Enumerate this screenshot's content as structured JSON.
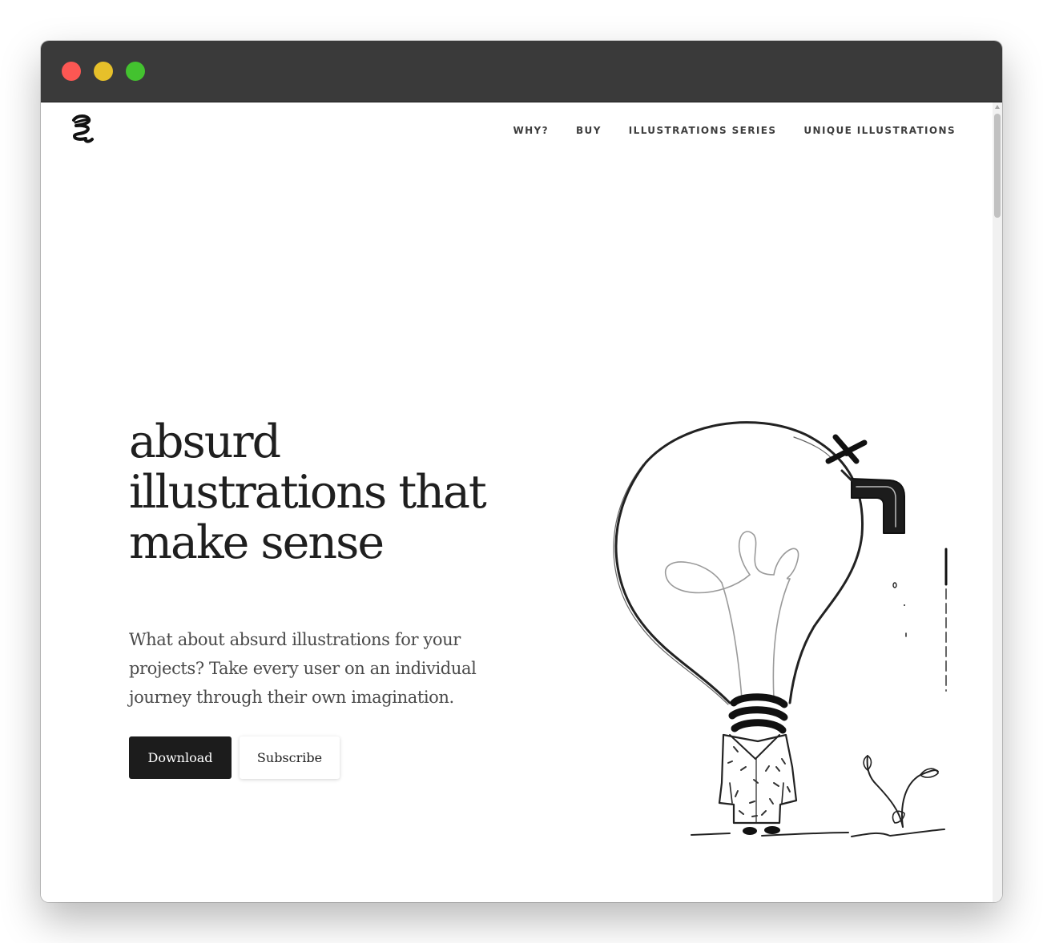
{
  "window": {
    "controls": [
      "close",
      "minimize",
      "maximize"
    ],
    "colors": {
      "close": "#fc5753",
      "minimize": "#e6c02a",
      "maximize": "#43c22f",
      "titlebar": "#3a3a3a"
    }
  },
  "header": {
    "logo_icon": "scribble-logo-icon",
    "nav": [
      "WHY?",
      "BUY",
      "ILLUSTRATIONS SERIES",
      "UNIQUE ILLUSTRATIONS"
    ]
  },
  "hero": {
    "title": "absurd illustrations that make sense",
    "subtitle": "What about absurd illustrations for your projects? Take every user on an individual journey through their own imagination.",
    "buttons": {
      "primary": "Download",
      "secondary": "Subscribe"
    },
    "illustration_icon": "lightbulb-figure-with-faucet-illustration"
  },
  "colors": {
    "text": "#1f1f1f",
    "primary_button": "#1c1c1c"
  }
}
